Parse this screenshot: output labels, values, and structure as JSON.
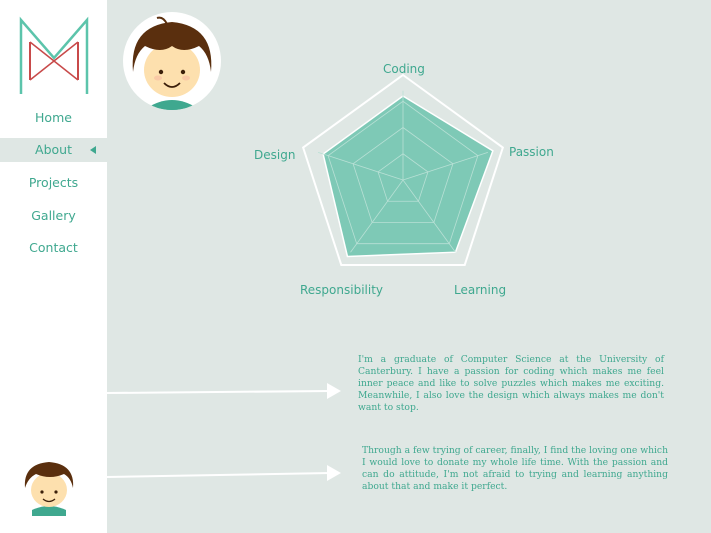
{
  "colors": {
    "accent": "#3fa88f",
    "logo_red": "#c84a4a",
    "background": "#dfe7e4",
    "radar_fill": "#7ec9b6"
  },
  "nav": {
    "items": [
      {
        "label": "Home",
        "active": false
      },
      {
        "label": "About",
        "active": true
      },
      {
        "label": "Projects",
        "active": false
      },
      {
        "label": "Gallery",
        "active": false
      },
      {
        "label": "Contact",
        "active": false
      }
    ]
  },
  "radar": {
    "axes": [
      "Coding",
      "Passion",
      "Learning",
      "Responsibility",
      "Design"
    ],
    "values": [
      0.8,
      0.9,
      0.85,
      0.9,
      0.8
    ]
  },
  "about": {
    "paragraph1": "I'm a graduate of Computer Science at the University of Canterbury. I have a passion for coding which makes me feel inner peace and like to solve puzzles which makes me exciting. Meanwhile, I also love the design which always makes me don't want to stop.",
    "paragraph2": "Through a few trying of career, finally, I find the loving one which I would love to donate my whole life time. With the passion and can do attitude, I'm not afraid to trying and learning anything about that and make it perfect."
  }
}
